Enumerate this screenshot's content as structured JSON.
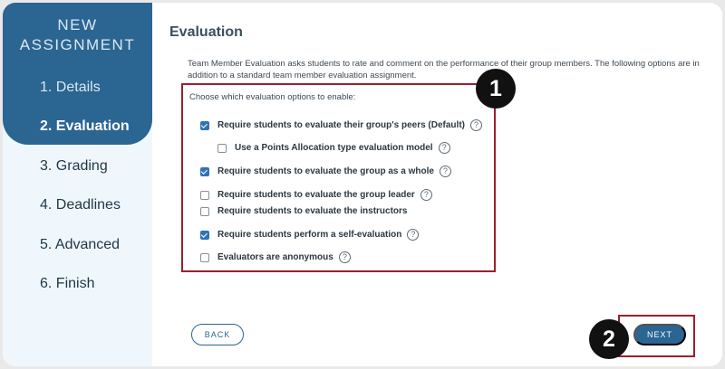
{
  "sidebar": {
    "title_line1": "NEW",
    "title_line2": "ASSIGNMENT",
    "steps": [
      {
        "label": "1. Details",
        "state": "done"
      },
      {
        "label": "2. Evaluation",
        "state": "active"
      },
      {
        "label": "3. Grading",
        "state": "pending"
      },
      {
        "label": "4. Deadlines",
        "state": "pending"
      },
      {
        "label": "5. Advanced",
        "state": "pending"
      },
      {
        "label": "6. Finish",
        "state": "pending"
      }
    ]
  },
  "main": {
    "title": "Evaluation",
    "intro": "Team Member Evaluation asks students to rate and comment on the performance of their group members. The following options are in addition to a standard team member evaluation assignment.",
    "options_heading": "Choose which evaluation options to enable:",
    "options": [
      {
        "label": "Require students to evaluate their group's peers (Default)",
        "checked": true
      },
      {
        "label": "Use a Points Allocation type evaluation model",
        "checked": false
      },
      {
        "label": "Require students to evaluate the group as a whole",
        "checked": true
      },
      {
        "label": "Require students to evaluate the group leader",
        "checked": false
      },
      {
        "label": "Require students to evaluate the instructors",
        "checked": false
      },
      {
        "label": "Require students perform a self-evaluation",
        "checked": true
      },
      {
        "label": "Evaluators are anonymous",
        "checked": false
      }
    ],
    "help_glyph": "?"
  },
  "callouts": {
    "one": "1",
    "two": "2"
  },
  "buttons": {
    "back": "BACK",
    "next": "NEXT"
  },
  "colors": {
    "brand": "#2b6592",
    "highlight": "#9b1f2e",
    "checkbox": "#2f73b7"
  }
}
